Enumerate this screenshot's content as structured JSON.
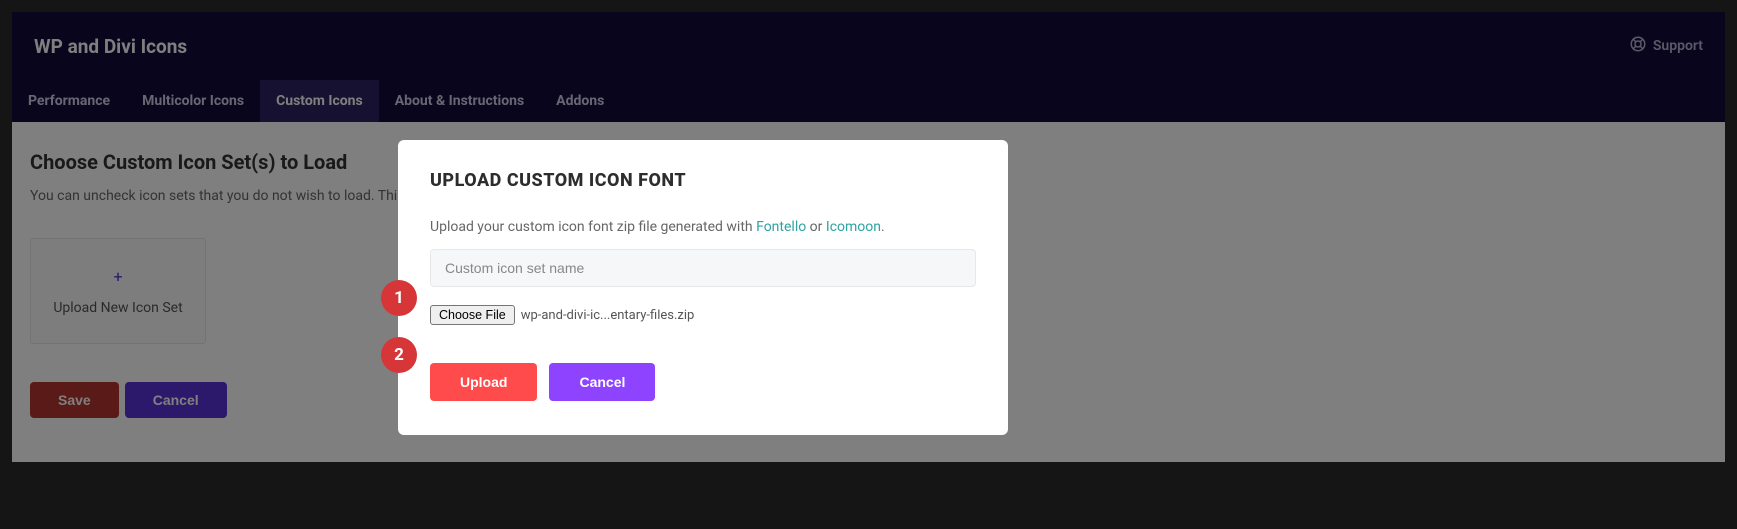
{
  "header": {
    "title": "WP and Divi Icons",
    "support_label": "Support"
  },
  "tabs": {
    "performance": "Performance",
    "multicolor": "Multicolor Icons",
    "custom": "Custom Icons",
    "about": "About & Instructions",
    "addons": "Addons"
  },
  "section": {
    "heading": "Choose Custom Icon Set(s) to Load",
    "subtext": "You can uncheck icon sets that you do not wish to load. This ca"
  },
  "upload_card": {
    "plus": "+",
    "label": "Upload New Icon Set"
  },
  "buttons": {
    "save": "Save",
    "cancel": "Cancel"
  },
  "modal": {
    "title": "UPLOAD CUSTOM ICON FONT",
    "desc_prefix": "Upload your custom icon font zip file generated with ",
    "link1": "Fontello",
    "or": " or ",
    "link2": "Icomoon",
    "period": ".",
    "input_placeholder": "Custom icon set name",
    "choose_file": "Choose File",
    "file_name": "wp-and-divi-ic...entary-files.zip",
    "upload": "Upload",
    "cancel": "Cancel"
  },
  "annotations": {
    "one": "1",
    "two": "2"
  }
}
